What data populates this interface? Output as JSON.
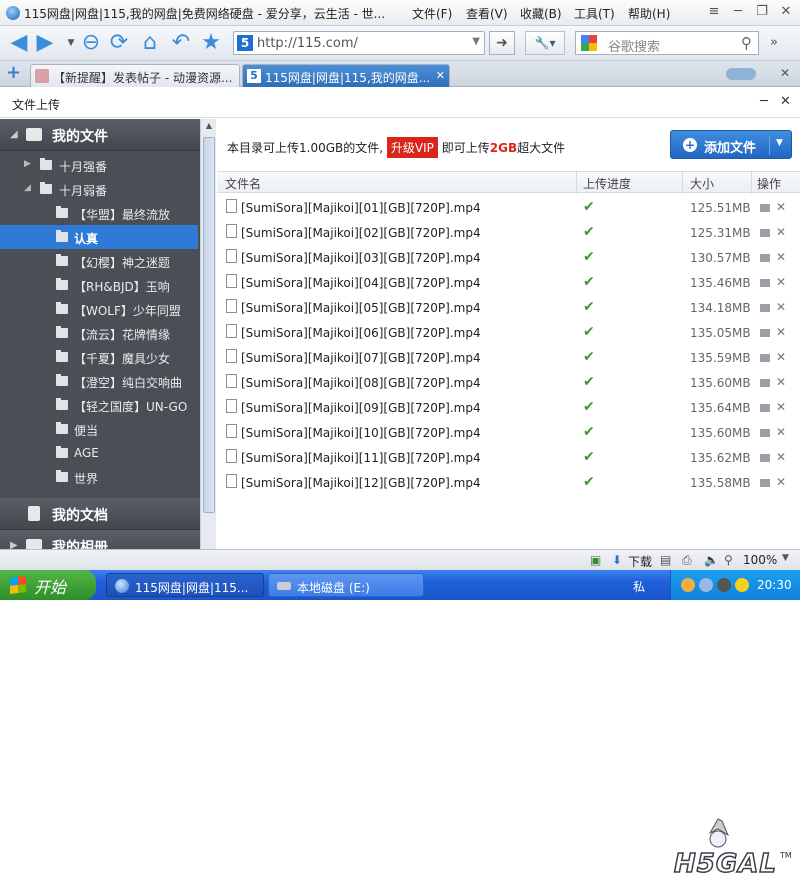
{
  "browser": {
    "window_title": "115网盘|网盘|115,我的网盘|免费网络硬盘 - 爱分享，云生活 - 世...",
    "menu": [
      "文件(F)",
      "查看(V)",
      "收藏(B)",
      "工具(T)",
      "帮助(H)"
    ],
    "url": "http://115.com/",
    "search_placeholder": "谷歌搜索",
    "tabs": [
      {
        "label": "【新提醒】发表帖子 - 动漫资源...",
        "active": false
      },
      {
        "label": "115网盘|网盘|115,我的网盘...",
        "active": true
      }
    ]
  },
  "dialog": {
    "title": "文件上传",
    "info_prefix": "本目录可上传1.00GB的文件,",
    "vip_label": "升级VIP",
    "info_mid": "即可上传",
    "info_highlight": "2GB",
    "info_suffix": "超大文件",
    "add_button": "添加文件",
    "columns": {
      "name": "文件名",
      "progress": "上传进度",
      "size": "大小",
      "ops": "操作"
    },
    "files": [
      {
        "name": "[SumiSora][Majikoi][01][GB][720P].mp4",
        "size": "125.51MB"
      },
      {
        "name": "[SumiSora][Majikoi][02][GB][720P].mp4",
        "size": "125.31MB"
      },
      {
        "name": "[SumiSora][Majikoi][03][GB][720P].mp4",
        "size": "130.57MB"
      },
      {
        "name": "[SumiSora][Majikoi][04][GB][720P].mp4",
        "size": "135.46MB"
      },
      {
        "name": "[SumiSora][Majikoi][05][GB][720P].mp4",
        "size": "134.18MB"
      },
      {
        "name": "[SumiSora][Majikoi][06][GB][720P].mp4",
        "size": "135.05MB"
      },
      {
        "name": "[SumiSora][Majikoi][07][GB][720P].mp4",
        "size": "135.59MB"
      },
      {
        "name": "[SumiSora][Majikoi][08][GB][720P].mp4",
        "size": "135.60MB"
      },
      {
        "name": "[SumiSora][Majikoi][09][GB][720P].mp4",
        "size": "135.64MB"
      },
      {
        "name": "[SumiSora][Majikoi][10][GB][720P].mp4",
        "size": "135.60MB"
      },
      {
        "name": "[SumiSora][Majikoi][11][GB][720P].mp4",
        "size": "135.62MB"
      },
      {
        "name": "[SumiSora][Majikoi][12][GB][720P].mp4",
        "size": "135.58MB"
      }
    ]
  },
  "sidebar": {
    "my_files": "我的文件",
    "my_docs": "我的文档",
    "my_album": "我的相册",
    "tree": [
      {
        "label": "十月强番",
        "level": 1,
        "twisty": "▶"
      },
      {
        "label": "十月弱番",
        "level": 1,
        "twisty": "◢"
      },
      {
        "label": "【华盟】最终流放",
        "level": 2
      },
      {
        "label": "认真",
        "level": 2,
        "selected": true
      },
      {
        "label": "【幻樱】神之迷题",
        "level": 2
      },
      {
        "label": "【RH&BJD】玉响",
        "level": 2
      },
      {
        "label": "【WOLF】少年同盟",
        "level": 2
      },
      {
        "label": "【流云】花牌情缘",
        "level": 2
      },
      {
        "label": "【千夏】魔具少女",
        "level": 2
      },
      {
        "label": "【澄空】纯白交响曲",
        "level": 2
      },
      {
        "label": "【轻之国度】UN-GO",
        "level": 2
      },
      {
        "label": "便当",
        "level": 2
      },
      {
        "label": "AGE",
        "level": 2
      },
      {
        "label": "世界",
        "level": 2
      }
    ]
  },
  "statusbar": {
    "download": "下载",
    "zoom": "100%"
  },
  "taskbar": {
    "start": "开始",
    "tasks": [
      "115网盘|网盘|115...",
      "本地磁盘 (E:)"
    ],
    "ime": "私",
    "clock": "20:30"
  },
  "watermark": {
    "text": "H5GAL",
    "tm": "TM"
  },
  "colors": {
    "accent": "#2f7ad6",
    "vip": "#d9261c",
    "check": "#3c9a2a",
    "sidebar": "#4a4f56"
  }
}
